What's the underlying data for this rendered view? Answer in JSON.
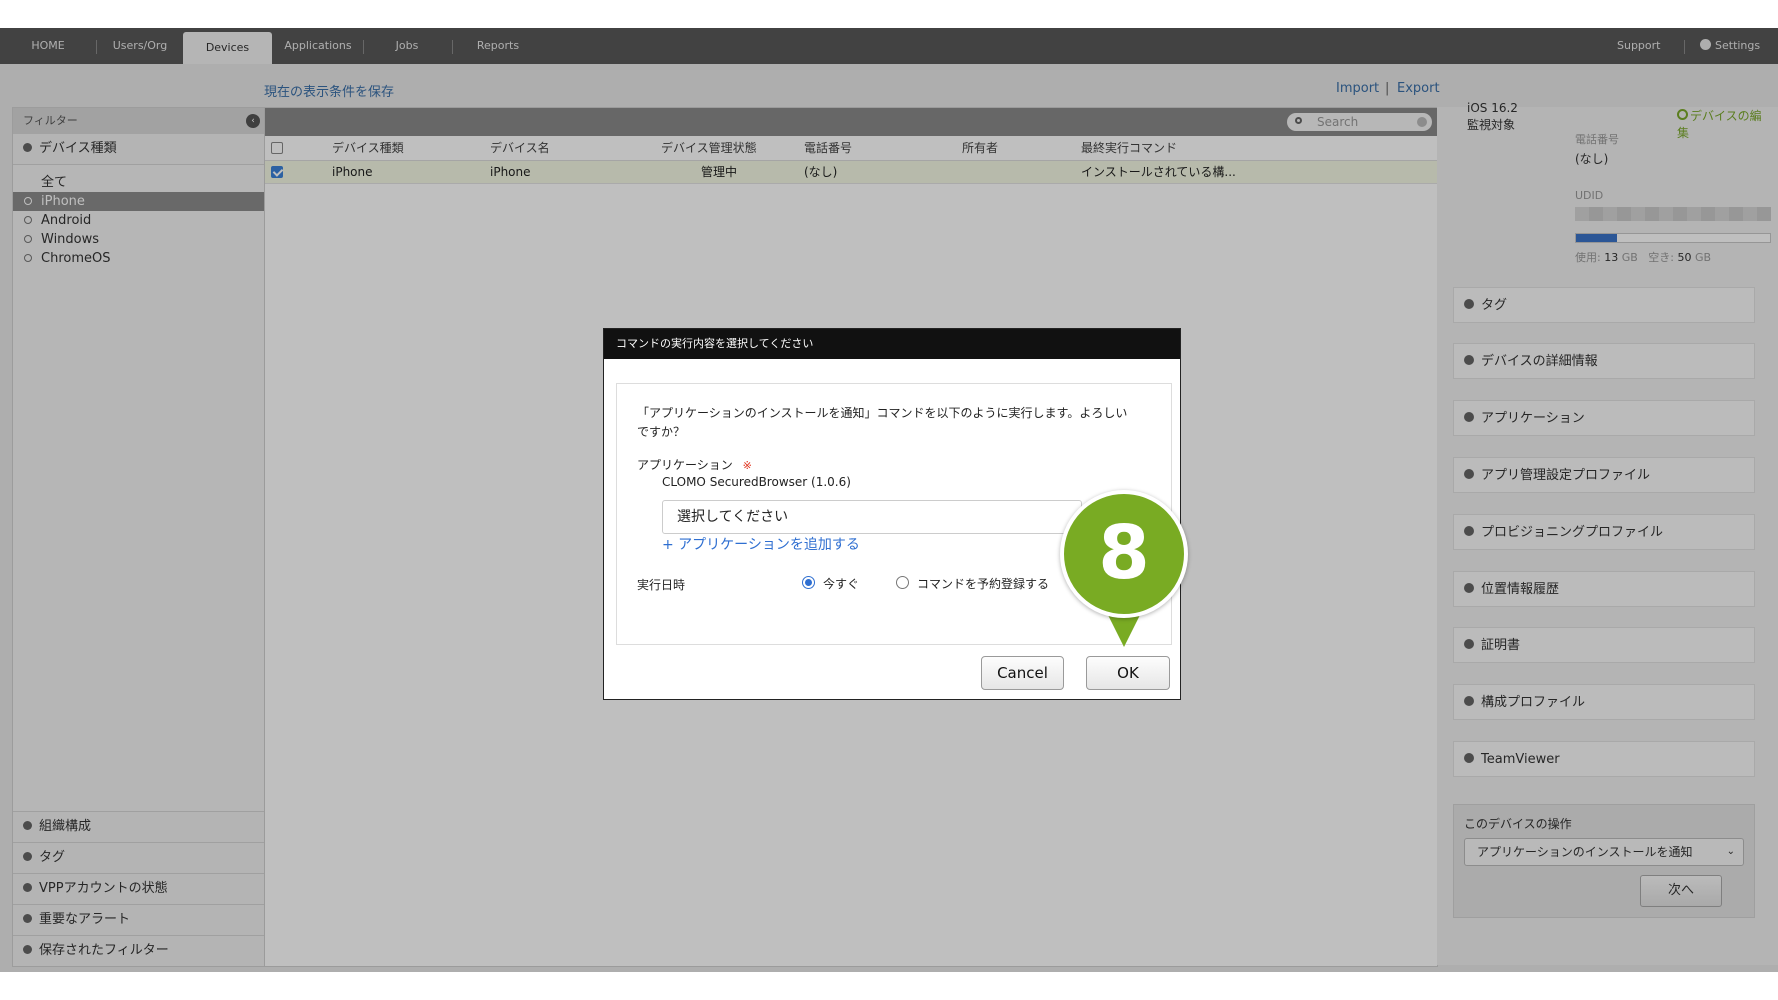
{
  "nav": {
    "tabs": [
      "HOME",
      "Users/Org",
      "Devices",
      "Applications",
      "Jobs",
      "Reports"
    ],
    "active_tab": "Devices",
    "support": "Support",
    "settings": "Settings"
  },
  "toolbar": {
    "save_view": "現在の表示条件を保存",
    "import": "Import",
    "separator": "|",
    "export": "Export"
  },
  "sidebar": {
    "header": "フィルター",
    "section_device_type": "デバイス種類",
    "items": [
      "全て",
      "iPhone",
      "Android",
      "Windows",
      "ChromeOS"
    ],
    "selected_item": "iPhone",
    "bottom_sections": [
      "組織構成",
      "タグ",
      "VPPアカウントの状態",
      "重要なアラート",
      "保存されたフィルター"
    ]
  },
  "table": {
    "search_placeholder": "Search",
    "columns": [
      "デバイス種類",
      "デバイス名",
      "デバイス管理状態",
      "電話番号",
      "所有者",
      "最終実行コマンド"
    ],
    "rows": [
      {
        "type": "iPhone",
        "name": "iPhone",
        "status": "管理中",
        "phone": "(なし)",
        "owner": "",
        "last_command": "インストールされている構..."
      }
    ]
  },
  "device_panel": {
    "os": "iOS 16.2",
    "supervised": "監視対象",
    "edit_link": "デバイスの編集",
    "phone_label": "電話番号",
    "phone_value": "(なし)",
    "udid_label": "UDID",
    "storage": {
      "used_label": "使用:",
      "used_value": "13",
      "unit": "GB",
      "free_label": "空き:",
      "free_value": "50",
      "used_fraction": 0.21
    },
    "sections": [
      "タグ",
      "デバイスの詳細情報",
      "アプリケーション",
      "アプリ管理設定プロファイル",
      "プロビジョニングプロファイル",
      "位置情報履歴",
      "証明書",
      "構成プロファイル",
      "TeamViewer"
    ],
    "operation_title": "このデバイスの操作",
    "operation_selected": "アプリケーションのインストールを通知",
    "next_button": "次へ"
  },
  "dialog": {
    "title": "コマンドの実行内容を選択してください",
    "message": "「アプリケーションのインストールを通知」コマンドを以下のように実行します。よろしいですか？",
    "app_label": "アプリケーション",
    "required_mark": "※",
    "app_value": "CLOMO SecuredBrowser (1.0.6)",
    "select_placeholder": "選択してください",
    "add_link": "+ アプリケーションを追加する",
    "date_label": "実行日時",
    "option_now": "今すぐ",
    "option_schedule": "コマンドを予約登録する",
    "selected_option": "今すぐ",
    "cancel": "Cancel",
    "ok": "OK"
  },
  "callout": {
    "number": "8",
    "color": "#79ab23"
  }
}
